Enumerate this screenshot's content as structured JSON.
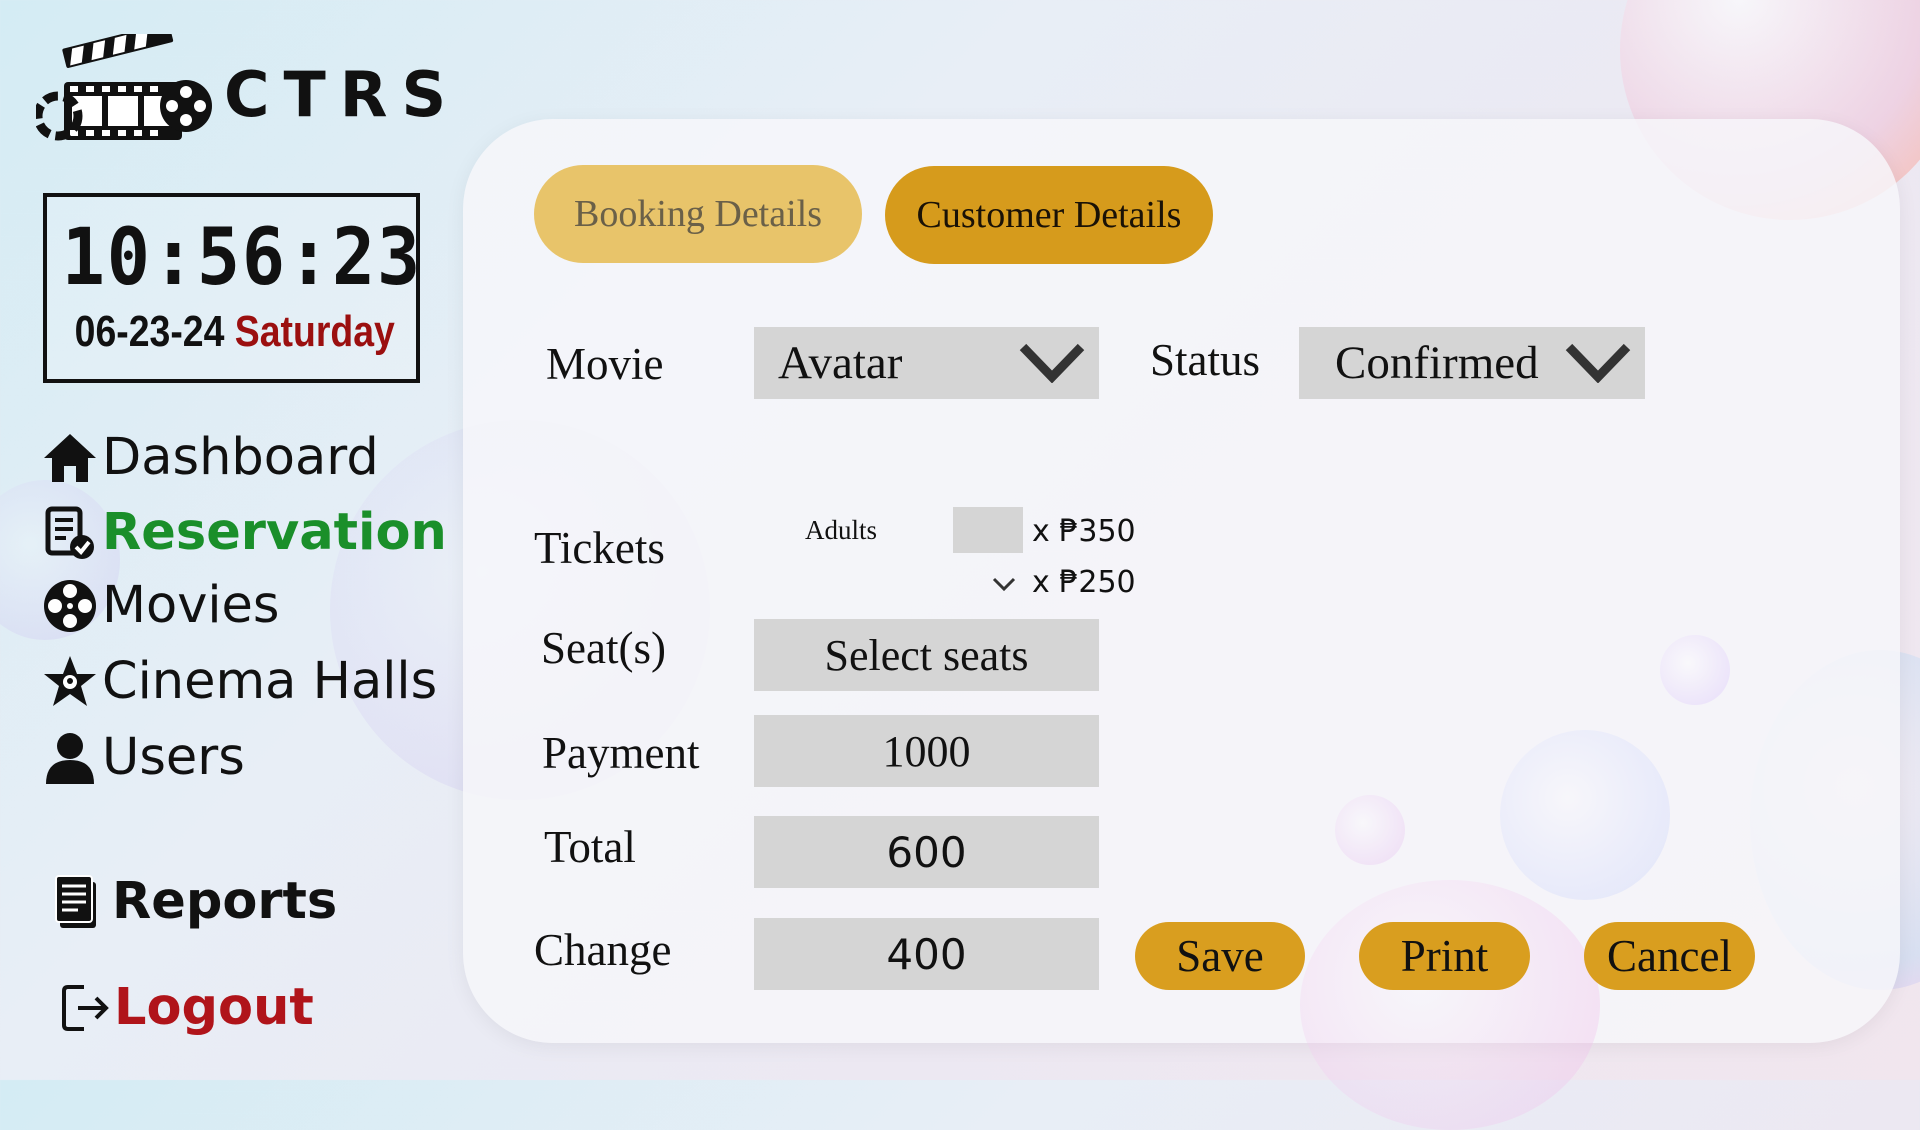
{
  "app": {
    "name": "CTRS"
  },
  "clock": {
    "time": "10:56:23",
    "date": "06-23-24",
    "day": "Saturday"
  },
  "sidebar": {
    "items": [
      {
        "label": "Dashboard",
        "icon": "home-icon"
      },
      {
        "label": "Reservation",
        "icon": "reservation-icon",
        "active": true
      },
      {
        "label": "Movies",
        "icon": "film-reel-icon"
      },
      {
        "label": "Cinema Halls",
        "icon": "star-hall-icon"
      },
      {
        "label": "Users",
        "icon": "user-icon"
      },
      {
        "label": "Reports",
        "icon": "report-icon"
      },
      {
        "label": "Logout",
        "icon": "logout-icon"
      }
    ]
  },
  "tabs": {
    "booking": "Booking Details",
    "customer": "Customer Details"
  },
  "form": {
    "movie_label": "Movie",
    "movie_value": "Avatar",
    "status_label": "Status",
    "status_value": "Confirmed",
    "tickets_label": "Tickets",
    "adults_label": "Adults",
    "adult_price": "x ₱350",
    "child_price": "x ₱250",
    "adults_qty": "",
    "seats_label": "Seat(s)",
    "seats_button": "Select seats",
    "payment_label": "Payment",
    "payment_value": "1000",
    "total_label": "Total",
    "total_value": "600",
    "change_label": "Change",
    "change_value": "400"
  },
  "actions": {
    "save": "Save",
    "print": "Print",
    "cancel": "Cancel"
  },
  "colors": {
    "accent": "#d99e1f",
    "tab_inactive": "#e8c46a",
    "active_nav": "#1a8f2a",
    "logout": "#b0141a",
    "day": "#9b0f0f"
  }
}
